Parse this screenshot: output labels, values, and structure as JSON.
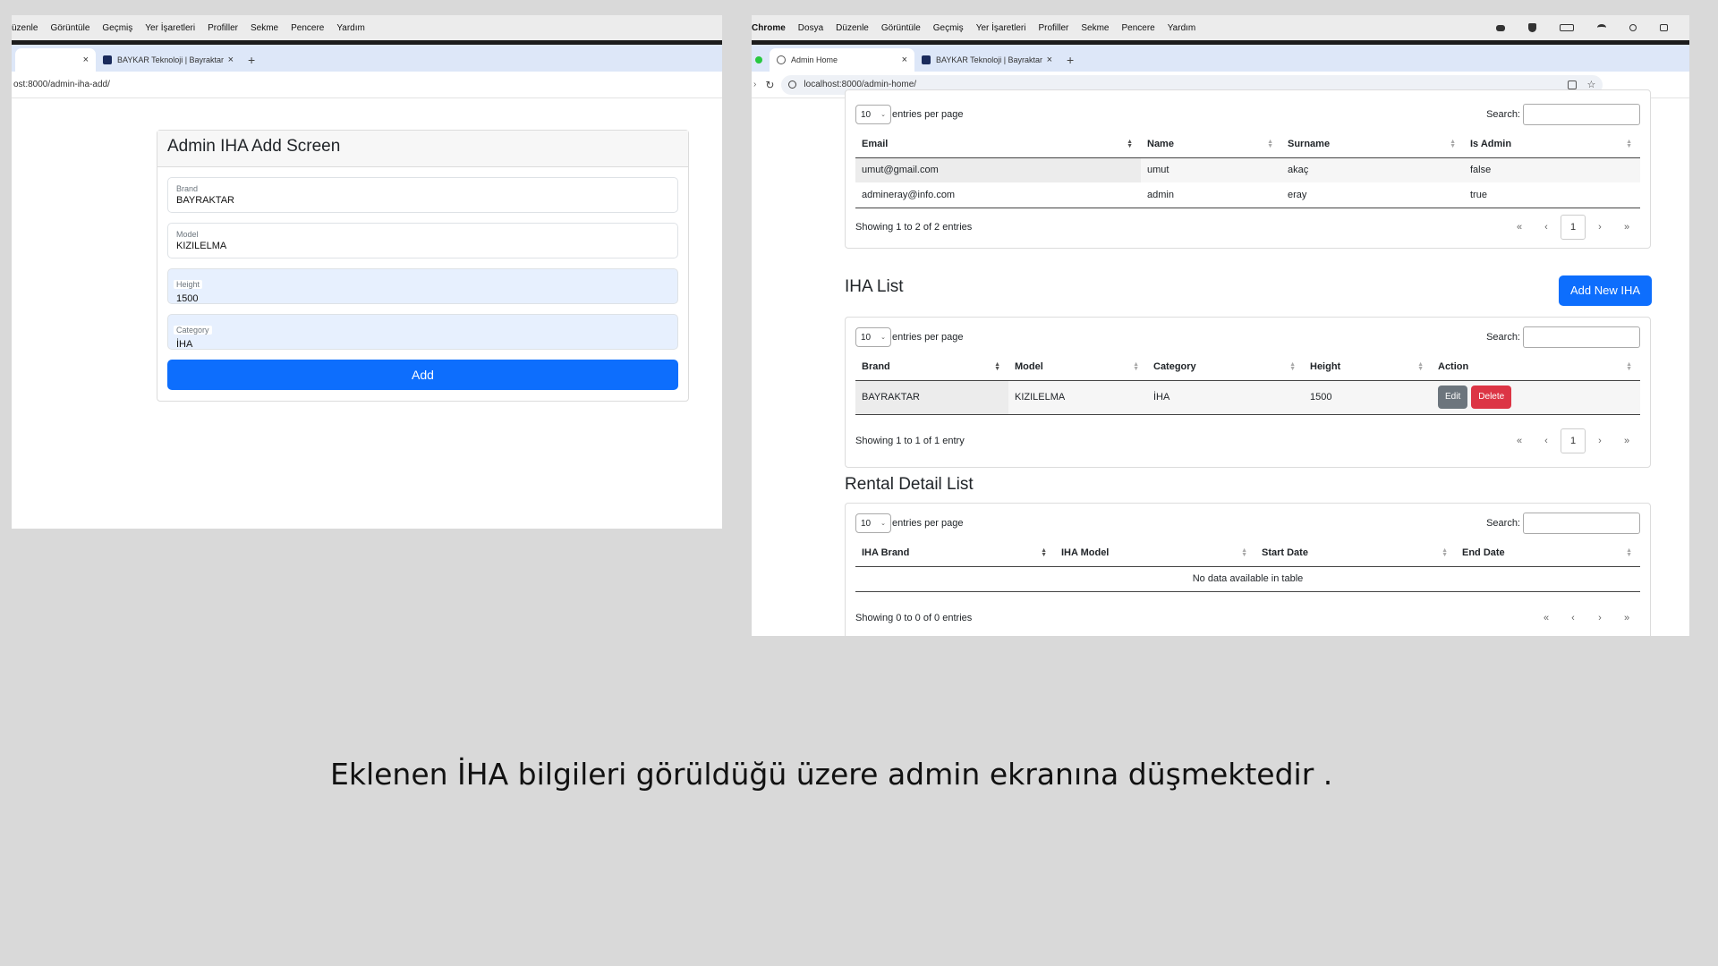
{
  "left_window": {
    "menu": [
      "üzenle",
      "Görüntüle",
      "Geçmiş",
      "Yer İşaretleri",
      "Profiller",
      "Sekme",
      "Pencere",
      "Yardım"
    ],
    "tab_close": "×",
    "tab2_title": "BAYKAR Teknoloji | Bayraktar",
    "new_tab": "+",
    "url": "ost:8000/admin-iha-add/",
    "form": {
      "title": "Admin IHA Add Screen",
      "fields": [
        {
          "label": "Brand",
          "value": "BAYRAKTAR"
        },
        {
          "label": "Model",
          "value": "KIZILELMA"
        },
        {
          "label": "Height",
          "value": "1500"
        },
        {
          "label": "Category",
          "value": "İHA"
        }
      ],
      "submit_label": "Add"
    }
  },
  "right_window": {
    "menu": [
      "Chrome",
      "Dosya",
      "Düzenle",
      "Görüntüle",
      "Geçmiş",
      "Yer İşaretleri",
      "Profiller",
      "Sekme",
      "Pencere",
      "Yardım"
    ],
    "tab1_title": "Admin Home",
    "tab2_title": "BAYKAR Teknoloji | Bayraktar",
    "tab_close": "×",
    "new_tab": "+",
    "url": "localhost:8000/admin-home/",
    "page_size": "10",
    "entries_label": "entries per page",
    "search_label": "Search:",
    "pager": {
      "first": "«",
      "prev": "‹",
      "page": "1",
      "next": "›",
      "last": "»"
    },
    "users_table": {
      "columns": [
        "Email",
        "Name",
        "Surname",
        "Is Admin"
      ],
      "rows": [
        [
          "umut@gmail.com",
          "umut",
          "akaç",
          "false"
        ],
        [
          "admineray@info.com",
          "admin",
          "eray",
          "true"
        ]
      ],
      "info": "Showing 1 to 2 of 2 entries"
    },
    "iha_section": {
      "title": "IHA List",
      "add_button": "Add New IHA",
      "columns": [
        "Brand",
        "Model",
        "Category",
        "Height",
        "Action"
      ],
      "rows": [
        [
          "BAYRAKTAR",
          "KIZILELMA",
          "İHA",
          "1500"
        ]
      ],
      "edit_label": "Edit",
      "delete_label": "Delete",
      "info": "Showing 1 to 1 of 1 entry"
    },
    "rental_section": {
      "title": "Rental Detail List",
      "columns": [
        "IHA Brand",
        "IHA Model",
        "Start Date",
        "End Date"
      ],
      "empty_text": "No data available in table",
      "info": "Showing 0 to 0 of 0 entries"
    }
  },
  "caption": "Eklenen İHA bilgileri görüldüğü üzere admin ekranına düşmektedir ."
}
